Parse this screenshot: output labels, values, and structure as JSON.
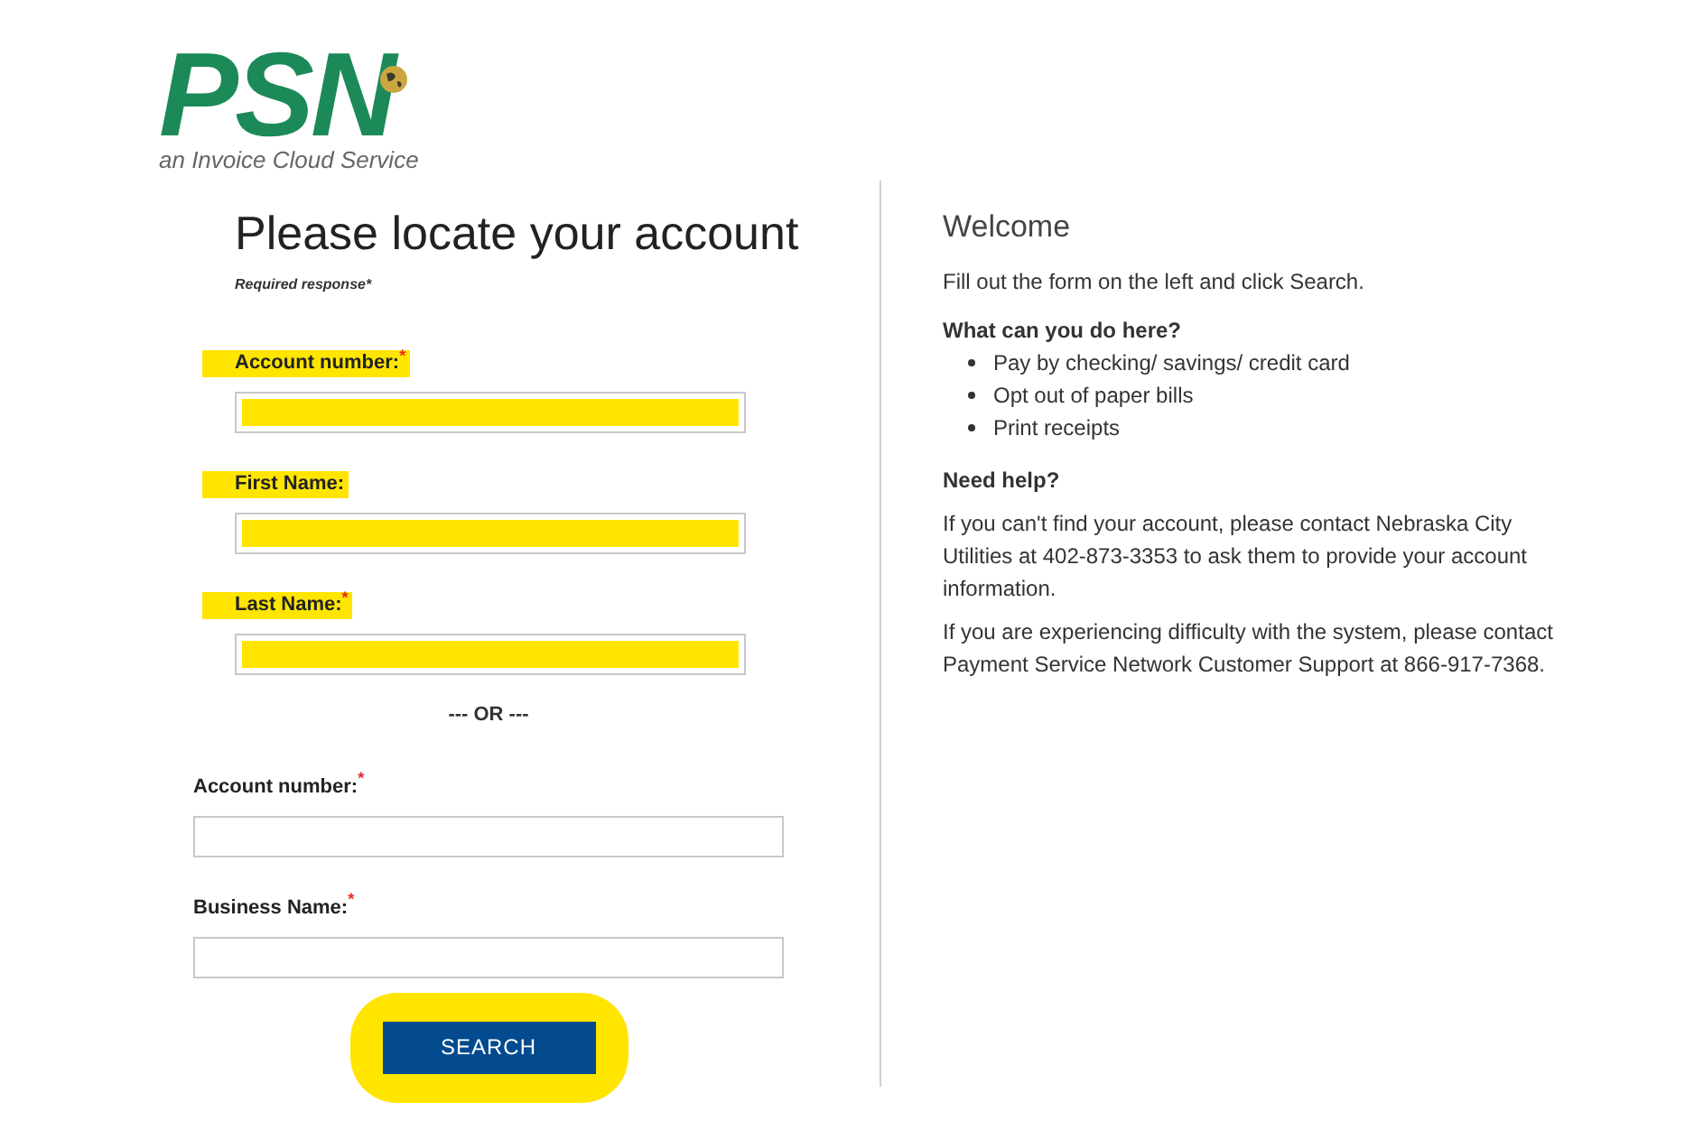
{
  "logo": {
    "mark": "PSN",
    "tagline": "an Invoice Cloud Service"
  },
  "form": {
    "heading": "Please locate your account",
    "required_note": "Required response*",
    "name_fields": [
      {
        "label": "Account number:",
        "required_mark": "*",
        "highlighted": true
      },
      {
        "label": "First Name:",
        "highlighted": true
      },
      {
        "label": "Last Name:",
        "required_mark": "*",
        "highlighted": true
      }
    ],
    "separator": "--- OR ---",
    "business_fields": [
      {
        "label": "Account number:",
        "required_mark": "*",
        "highlighted": false
      },
      {
        "label": "Business Name:",
        "required_mark": "*",
        "highlighted": false
      }
    ],
    "button": {
      "label": "SEARCH",
      "highlighted": true
    }
  },
  "welcome": {
    "title": "Welcome",
    "intro": "Fill out the form on the left and click Search.",
    "what_heading": "What can you do here?",
    "items": [
      "Pay by checking/ savings/ credit card",
      "Opt out of paper bills",
      "Print receipts"
    ],
    "help_heading": "Need help?",
    "help_paragraphs": [
      "If you can't find your account, please contact Nebraska City Utilities at 402-873-3353 to ask them to provide your account information.",
      "If you are experiencing difficulty with the system, please contact Payment Service Network Customer Support at 866-917-7368."
    ]
  }
}
